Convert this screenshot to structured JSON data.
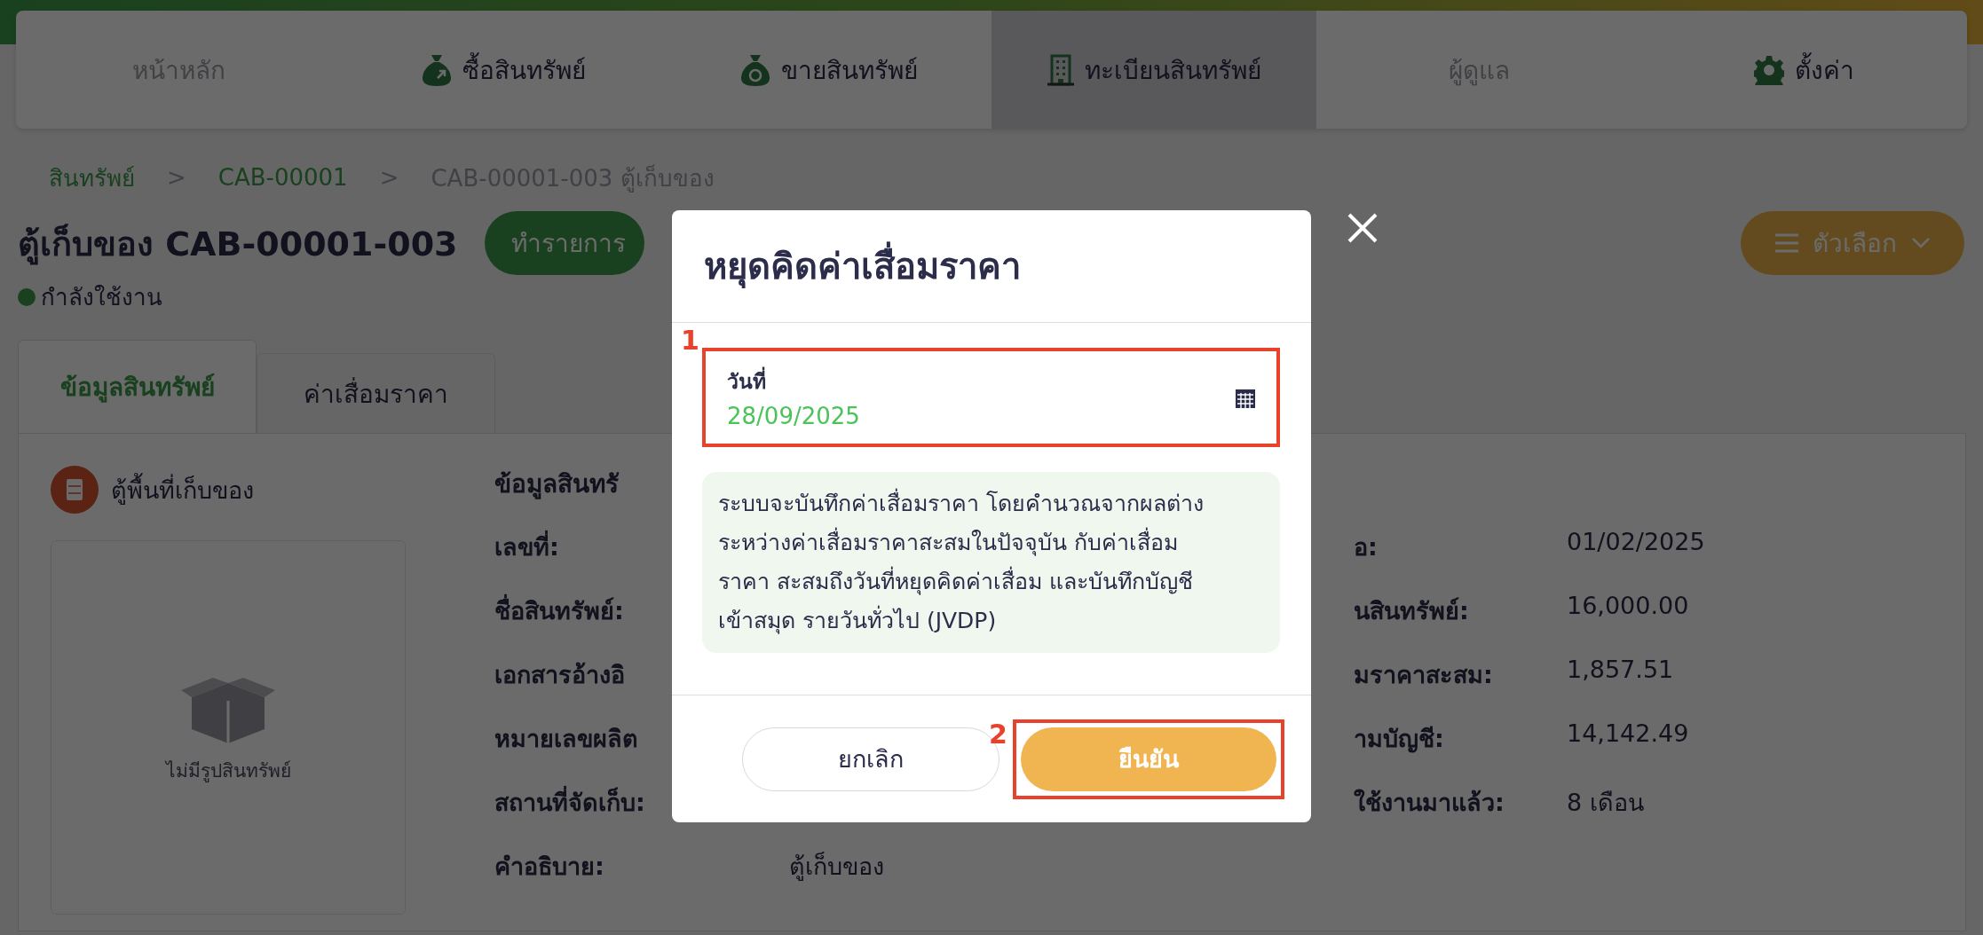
{
  "nav": [
    {
      "label": "หน้าหลัก",
      "disabled": true,
      "selected": false
    },
    {
      "label": "ซื้อสินทรัพย์",
      "disabled": false,
      "selected": false
    },
    {
      "label": "ขายสินทรัพย์",
      "disabled": false,
      "selected": false
    },
    {
      "label": "ทะเบียนสินทรัพย์",
      "disabled": false,
      "selected": true
    },
    {
      "label": "ผู้ดูแล",
      "disabled": true,
      "selected": false
    },
    {
      "label": "ตั้งค่า",
      "disabled": false,
      "selected": false
    }
  ],
  "breadcrumb": [
    {
      "label": "สินทรัพย์",
      "link": true
    },
    {
      "label": "CAB-00001",
      "link": true
    },
    {
      "label": "CAB-00001-003 ตู้เก็บของ",
      "link": false
    }
  ],
  "breadcrumb_separator": ">",
  "title": "ตู้เก็บของ CAB-00001-003",
  "status": "กำลังใช้งาน",
  "action_button": "ทำรายการ",
  "options_button": "ตัวเลือก",
  "tabs": [
    {
      "label": "ข้อมูลสินทรัพย์",
      "selected": true
    },
    {
      "label": "ค่าเสื่อมราคา",
      "selected": false
    }
  ],
  "category": "ตู้พื้นที่เก็บของ",
  "no_image": "ไม่มีรูปสินทรัพย์",
  "section_title": "ข้อมูลสินทรั",
  "left_fields": [
    {
      "label": "เลขที่:"
    },
    {
      "label": "ชื่อสินทรัพย์:"
    },
    {
      "label": "เอกสารอ้างอิ"
    },
    {
      "label": "หมายเลขผลิต"
    },
    {
      "label": "สถานที่จัดเก็บ:"
    },
    {
      "label": "คำอธิบาย:",
      "value": "ตู้เก็บของ"
    }
  ],
  "right_fields": [
    {
      "label": "อ:",
      "value": "01/02/2025"
    },
    {
      "label": "นสินทรัพย์:",
      "value": "16,000.00"
    },
    {
      "label": "มราคาสะสม:",
      "value": "1,857.51"
    },
    {
      "label": "ามบัญชี:",
      "value": "14,142.49"
    },
    {
      "label": "ใช้งานมาแล้ว:",
      "value": "8 เดือน"
    }
  ],
  "dialog": {
    "title": "หยุดคิดค่าเสื่อมราคา",
    "date_label": "วันที่",
    "date_value": "28/09/2025",
    "note": "ระบบจะบันทึกค่าเสื่อมราคา โดยคำนวณจากผลต่าง ระหว่างค่าเสื่อมราคาสะสมในปัจจุบัน กับค่าเสื่อมราคา สะสมถึงวันที่หยุดคิดค่าเสื่อม และบันทึกบัญชีเข้าสมุด รายวันทั่วไป (JVDP)",
    "cancel_button": "ยกเลิก",
    "confirm_button": "ยืนยัน"
  },
  "annotations": [
    "1",
    "2"
  ]
}
